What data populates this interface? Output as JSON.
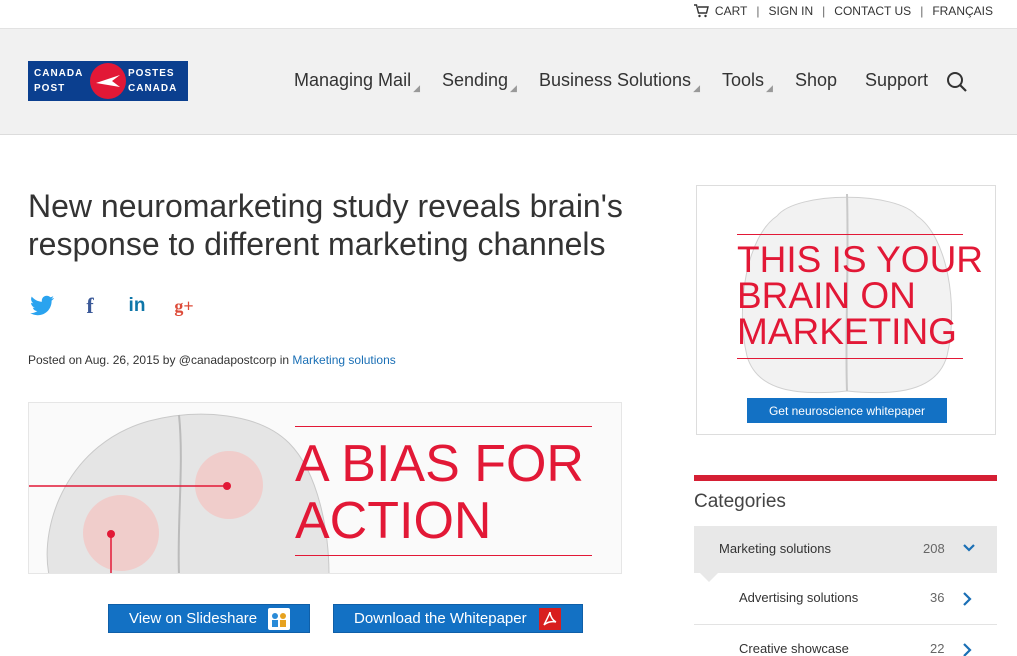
{
  "utility": {
    "cart": "CART",
    "sign_in": "SIGN IN",
    "contact": "CONTACT US",
    "language": "FRANÇAIS",
    "separator": "|"
  },
  "logo": {
    "line1_left": "CANADA",
    "line2_left": "POST",
    "line1_right": "POSTES",
    "line2_right": "CANADA"
  },
  "nav": {
    "items": [
      {
        "label": "Managing Mail",
        "has_menu": true
      },
      {
        "label": "Sending",
        "has_menu": true
      },
      {
        "label": "Business Solutions",
        "has_menu": true
      },
      {
        "label": "Tools",
        "has_menu": true
      },
      {
        "label": "Shop",
        "has_menu": false
      },
      {
        "label": "Support",
        "has_menu": false
      }
    ],
    "search_icon": "search-icon"
  },
  "article": {
    "headline_line1": "New neuromarketing study reveals brain's",
    "headline_line2": "response to different marketing channels",
    "social": [
      "twitter-icon",
      "facebook-icon",
      "linkedin-icon",
      "google-plus-icon"
    ],
    "byline_prefix": "Posted on Aug. 26, 2015 by @canadapostcorp in ",
    "byline_link": "Marketing solutions",
    "banner_line1": "A BIAS FOR",
    "banner_line2": "ACTION",
    "btn_slideshare": "View on Slideshare",
    "btn_whitepaper": "Download the Whitepaper"
  },
  "ad": {
    "line1": "THIS IS YOUR",
    "line2": "BRAIN ON",
    "line3": "MARKETING",
    "button": "Get neuroscience whitepaper"
  },
  "categories": {
    "title": "Categories",
    "main": {
      "name": "Marketing solutions",
      "count": "208"
    },
    "sub": [
      {
        "name": "Advertising solutions",
        "count": "36"
      },
      {
        "name": "Creative showcase",
        "count": "22"
      }
    ]
  },
  "colors": {
    "brand_red": "#e21836",
    "brand_blue": "#0b3f8f",
    "button_blue": "#1371c4",
    "link_blue": "#1a6fb5"
  }
}
